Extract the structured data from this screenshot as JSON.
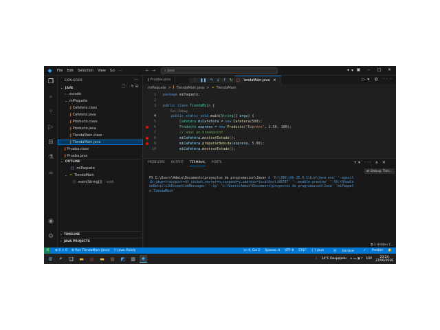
{
  "titlebar": {
    "menu": [
      "File",
      "Edit",
      "Selection",
      "View",
      "Go",
      "···"
    ],
    "search": "Java"
  },
  "sidebar": {
    "title": "EXPLORER",
    "project": "JAVA",
    "tree": [
      {
        "label": ".vscode",
        "type": "folder"
      },
      {
        "label": "miPaquete",
        "type": "folder-open"
      },
      {
        "label": "Cafetera.class",
        "type": "class"
      },
      {
        "label": "Cafetera.java",
        "type": "java"
      },
      {
        "label": "Producto.class",
        "type": "class"
      },
      {
        "label": "Producto.java",
        "type": "java"
      },
      {
        "label": "TiendaMain.class",
        "type": "class"
      },
      {
        "label": "TiendaMain.java",
        "type": "java"
      },
      {
        "label": "Prueba.class",
        "type": "class"
      },
      {
        "label": "Prueba.java",
        "type": "java"
      }
    ],
    "outline": {
      "title": "OUTLINE",
      "items": [
        "miPaquete",
        "TiendaMain",
        "main(String[])"
      ],
      "main_meta": ": void"
    },
    "timeline": "TIMELINE",
    "java_projects": "JAVA PROJECTS"
  },
  "tabs": [
    {
      "label": "Prueba.java",
      "active": false
    },
    {
      "label": "va",
      "active": false
    },
    {
      "label": "TiendaMain.java",
      "active": true
    }
  ],
  "breadcrumb": [
    "miPaquete",
    ">",
    "TiendaMain.java",
    ">",
    "TiendaMain"
  ],
  "code": {
    "line1": "package miPaquete;",
    "codelens": "Run | Debug",
    "line_numbers": [
      "1",
      "2",
      "3",
      "4",
      "5",
      "6",
      "7",
      "8",
      "9",
      "10"
    ]
  },
  "panel": {
    "tabs": [
      "PROBLEMS",
      "OUTPUT",
      "TERMINAL",
      "PORTS"
    ],
    "active_tab": "TERMINAL",
    "terminal_label": "Debug: Tien...",
    "prompt": "PS C:\\Users\\Admin\\Documents\\proyectos de programacion\\Java> ",
    "command": " & 'D:\\JDK\\jdk-25.0.1\\bin\\java.exe' '-agentlib:jdwp=transport=dt_socket,server=n,suspend=y,address=localhost:09797' '--enable-preview' '-XX:+ShowCodeDetailsInExceptionMessages' '-cp' 'c:\\Users\\Admin\\Documents\\proyectos de programacion\\Java' 'miPaquete.TiendaMain'",
    "hidden": "1 Hidden T..."
  },
  "statusbar": {
    "left": [
      "⊗ 0  ⚠ 0",
      "Run TiendaMain (Java)",
      "Java: Ready"
    ],
    "right": [
      "Ln 4, Col 2",
      "Spaces: 4",
      "UTF-8",
      "CRLF",
      "{ } Java",
      "Go Live",
      "Prettier"
    ]
  },
  "taskbar": {
    "weather": "14°C  Despejado",
    "lang": "ESP",
    "time": "23:24",
    "date": "27/06/2026"
  },
  "colors": {
    "accent": "#0078d4",
    "breakpoint": "#e51400"
  }
}
